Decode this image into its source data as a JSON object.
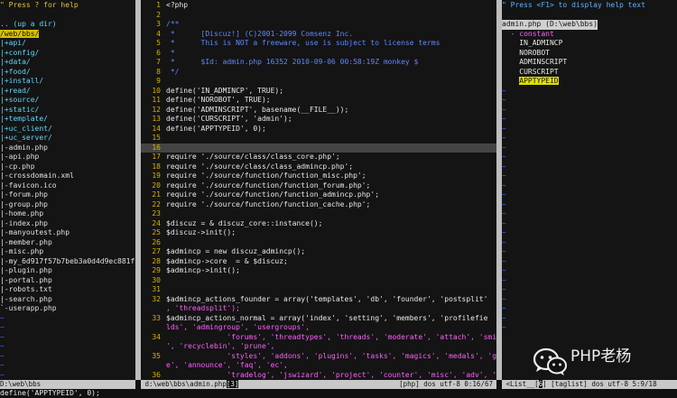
{
  "explorer": {
    "help": "\" Press ? for help",
    "up": ".. (up a dir)",
    "cwd": "/web/bbs/",
    "items": [
      {
        "text": "|+api/",
        "type": "dir"
      },
      {
        "text": "|+config/",
        "type": "dir"
      },
      {
        "text": "|+data/",
        "type": "dir"
      },
      {
        "text": "|+food/",
        "type": "dir"
      },
      {
        "text": "|+install/",
        "type": "dir"
      },
      {
        "text": "|+read/",
        "type": "dir"
      },
      {
        "text": "|+source/",
        "type": "dir"
      },
      {
        "text": "|+static/",
        "type": "dir"
      },
      {
        "text": "|+template/",
        "type": "dir"
      },
      {
        "text": "|+uc_client/",
        "type": "dir"
      },
      {
        "text": "|+uc_server/",
        "type": "dir"
      },
      {
        "text": "|-admin.php",
        "type": "file"
      },
      {
        "text": "|-api.php",
        "type": "file"
      },
      {
        "text": "|-cp.php",
        "type": "file"
      },
      {
        "text": "|-crossdomain.xml",
        "type": "file"
      },
      {
        "text": "|-favicon.ico",
        "type": "file"
      },
      {
        "text": "|-forum.php",
        "type": "file"
      },
      {
        "text": "|-group.php",
        "type": "file"
      },
      {
        "text": "|-home.php",
        "type": "file"
      },
      {
        "text": "|-index.php",
        "type": "file"
      },
      {
        "text": "|-manyoutest.php",
        "type": "file"
      },
      {
        "text": "|-member.php",
        "type": "file"
      },
      {
        "text": "|-misc.php",
        "type": "file"
      },
      {
        "text": "|-my_6d917f57b7beb3a0d4d9ec881f",
        "type": "file"
      },
      {
        "text": "|-plugin.php",
        "type": "file"
      },
      {
        "text": "|-portal.php",
        "type": "file"
      },
      {
        "text": "|-robots.txt",
        "type": "file"
      },
      {
        "text": "|-search.php",
        "type": "file"
      },
      {
        "text": "`-userapp.php",
        "type": "file"
      }
    ],
    "tilde": "~",
    "status": "D:\\web\\bbs"
  },
  "editor": {
    "lines": [
      {
        "n": "1",
        "t": "<?php",
        "c": "php"
      },
      {
        "n": "2",
        "t": "",
        "c": "php"
      },
      {
        "n": "3",
        "t": "/**",
        "c": "comment"
      },
      {
        "n": "4",
        "t": " *      [Discuz!] (C)2001-2099 Comsenz Inc.",
        "c": "comment"
      },
      {
        "n": "5",
        "t": " *      This is NOT a freeware, use is subject to license terms",
        "c": "comment"
      },
      {
        "n": "6",
        "t": " *",
        "c": "comment"
      },
      {
        "n": "7",
        "t": " *      $Id: admin.php 16352 2010-09-06 00:58:19Z monkey $",
        "c": "comment"
      },
      {
        "n": "8",
        "t": " */",
        "c": "comment"
      },
      {
        "n": "9",
        "t": "",
        "c": "php"
      },
      {
        "n": "10",
        "t": "define('IN_ADMINCP', TRUE);",
        "c": "func"
      },
      {
        "n": "11",
        "t": "define('NOROBOT', TRUE);",
        "c": "func"
      },
      {
        "n": "12",
        "t": "define('ADMINSCRIPT', basename(__FILE__));",
        "c": "func"
      },
      {
        "n": "13",
        "t": "define('CURSCRIPT', 'admin');",
        "c": "func"
      },
      {
        "n": "14",
        "t": "define('APPTYPEID', 0);",
        "c": "func"
      },
      {
        "n": "15",
        "t": "",
        "c": "php"
      },
      {
        "n": "16",
        "t": "",
        "c": "hl"
      },
      {
        "n": "17",
        "t": "require './source/class/class_core.php';",
        "c": "func"
      },
      {
        "n": "18",
        "t": "require './source/class/class_admincp.php';",
        "c": "func"
      },
      {
        "n": "19",
        "t": "require './source/function/function_misc.php';",
        "c": "func"
      },
      {
        "n": "20",
        "t": "require './source/function/function_forum.php';",
        "c": "func"
      },
      {
        "n": "21",
        "t": "require './source/function/function_admincp.php';",
        "c": "func"
      },
      {
        "n": "22",
        "t": "require './source/function/function_cache.php';",
        "c": "func"
      },
      {
        "n": "23",
        "t": "",
        "c": "php"
      },
      {
        "n": "24",
        "t": "$discuz = & discuz_core::instance();",
        "c": "php"
      },
      {
        "n": "25",
        "t": "$discuz->init();",
        "c": "php"
      },
      {
        "n": "26",
        "t": "",
        "c": "php"
      },
      {
        "n": "27",
        "t": "$admincp = new discuz_admincp();",
        "c": "php"
      },
      {
        "n": "28",
        "t": "$admincp->core  = & $discuz;",
        "c": "php"
      },
      {
        "n": "29",
        "t": "$admincp->init();",
        "c": "php"
      },
      {
        "n": "30",
        "t": "",
        "c": "php"
      },
      {
        "n": "31",
        "t": "",
        "c": "php"
      },
      {
        "n": "32",
        "t": "$admincp_actions_founder = array('templates', 'db', 'founder', 'postsplit'",
        "c": "php"
      },
      {
        "n": "",
        "t": ", 'threadsplit');",
        "c": "str"
      },
      {
        "n": "33",
        "t": "$admincp_actions_normal = array('index', 'setting', 'members', 'profilefie",
        "c": "php"
      },
      {
        "n": "",
        "t": "lds', 'admingroup', 'usergroups',",
        "c": "str"
      },
      {
        "n": "34",
        "t": "              'forums', 'threadtypes', 'threads', 'moderate', 'attach', 'smilies",
        "c": "str"
      },
      {
        "n": "",
        "t": "', 'recyclebin', 'prune',",
        "c": "str"
      },
      {
        "n": "35",
        "t": "              'styles', 'addons', 'plugins', 'tasks', 'magics', 'medals', 'googl",
        "c": "str"
      },
      {
        "n": "",
        "t": "e', 'announce', 'faq', 'ec',",
        "c": "str"
      },
      {
        "n": "36",
        "t": "              'tradelog', 'jswizard', 'project', 'counter', 'misc', 'adv', 'logs",
        "c": "str"
      },
      {
        "n": "",
        "t": "', 'tools', 'portalperm',",
        "c": "str"
      }
    ],
    "status_file": "d:\\web\\bbs\\admin.php",
    "status_bufnum": "[3]",
    "status_right": "[php] dos utf-8 0:16/67"
  },
  "tagbar": {
    "help": "\" Press <F1> to display help text",
    "title": "admin.php (D:\\web\\bbs)",
    "group": "- constant",
    "items": [
      "IN_ADMINCP",
      "NOROBOT",
      "ADMINSCRIPT",
      "CURSCRIPT",
      "APPTYPEID"
    ],
    "selected_index": 4,
    "status_left": "<List__[",
    "status_bufnum": "6",
    "status_right": "] [taglist] dos utf-8 5:9/18"
  },
  "cmdline": "define('APPTYPEID', 0);",
  "watermark": {
    "text": "PHP老杨",
    "icon": "wechat-icon"
  }
}
